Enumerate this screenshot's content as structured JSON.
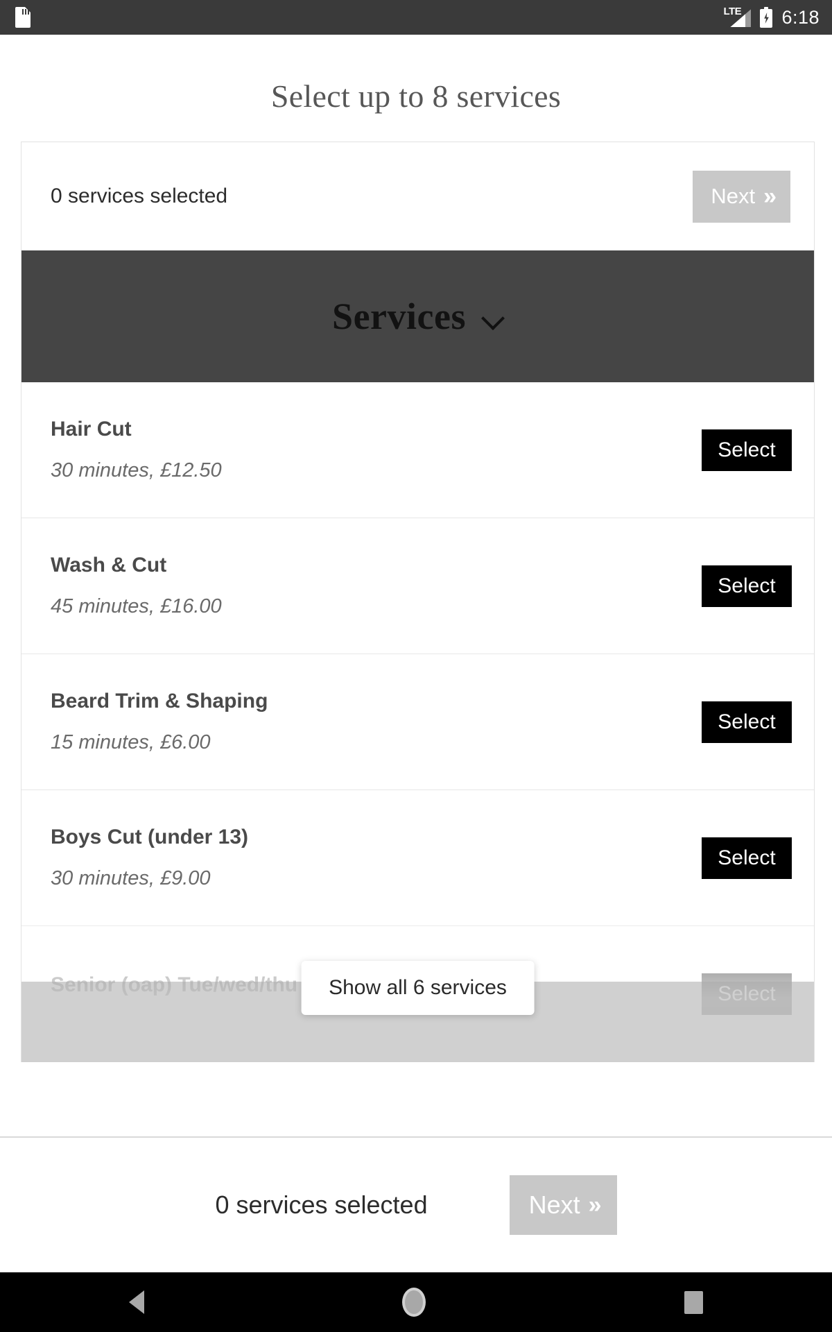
{
  "status_bar": {
    "sd_icon": "sd-card-icon",
    "network_label": "LTE",
    "signal_icon": "signal-bars-icon",
    "battery_icon": "battery-charging-icon",
    "time": "6:18"
  },
  "page_title": "Select up to 8 services",
  "top_panel": {
    "selected_text": "0 services selected",
    "next_label": "Next",
    "next_chevron": "double-chevron-right-icon",
    "next_disabled_color": "#c8c8c8"
  },
  "section": {
    "header_title": "Services",
    "header_bg": "#454545",
    "chevron_icon": "chevron-down-icon"
  },
  "services": [
    {
      "name": "Hair Cut",
      "meta": "30 minutes, £12.50",
      "action": "Select"
    },
    {
      "name": "Wash & Cut",
      "meta": "45 minutes, £16.00",
      "action": "Select"
    },
    {
      "name": "Beard Trim & Shaping",
      "meta": "15 minutes, £6.00",
      "action": "Select"
    },
    {
      "name": "Boys Cut (under 13)",
      "meta": "30 minutes, £9.00",
      "action": "Select"
    },
    {
      "name": "Senior (oap) Tue/wed/thu Daytime",
      "meta": "",
      "action": "Select"
    }
  ],
  "show_all": {
    "label": "Show all 6 services"
  },
  "bottom_bar": {
    "selected_text": "0 services selected",
    "next_label": "Next",
    "next_chevron": "double-chevron-right-icon"
  },
  "nav_bar": {
    "back": "back-triangle-icon",
    "home": "home-circle-icon",
    "recents": "recents-square-icon"
  }
}
